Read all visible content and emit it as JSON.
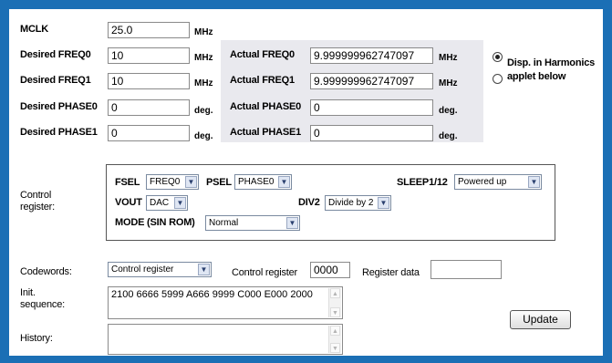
{
  "top": {
    "mclk": {
      "label": "MCLK",
      "value": "25.0",
      "unit": "MHz"
    },
    "freq0": {
      "label": "Desired FREQ0",
      "value": "10",
      "unit": "MHz"
    },
    "freq1": {
      "label": "Desired FREQ1",
      "value": "10",
      "unit": "MHz"
    },
    "phase0": {
      "label": "Desired PHASE0",
      "value": "0",
      "unit": "deg."
    },
    "phase1": {
      "label": "Desired PHASE1",
      "value": "0",
      "unit": "deg."
    },
    "actual_freq0": {
      "label": "Actual FREQ0",
      "value": "9.999999962747097",
      "unit": "MHz"
    },
    "actual_freq1": {
      "label": "Actual FREQ1",
      "value": "9.999999962747097",
      "unit": "MHz"
    },
    "actual_phase0": {
      "label": "Actual PHASE0",
      "value": "0",
      "unit": "deg."
    },
    "actual_phase1": {
      "label": "Actual PHASE1",
      "value": "0",
      "unit": "deg."
    },
    "radio_harmonics": "Disp. in Harmonics",
    "radio_applet": "applet below"
  },
  "control": {
    "label_line1": "Control",
    "label_line2": "register:",
    "fsel_label": "FSEL",
    "fsel_value": "FREQ0",
    "psel_label": "PSEL",
    "psel_value": "PHASE0",
    "sleep_label": "SLEEP1/12",
    "sleep_value": "Powered up",
    "vout_label": "VOUT",
    "vout_value": "DAC",
    "div2_label": "DIV2",
    "div2_value": "Divide by 2",
    "mode_label": "MODE (SIN ROM)",
    "mode_value": "Normal"
  },
  "bottom": {
    "codewords_label": "Codewords:",
    "codewords_value": "Control register",
    "control_register_label": "Control register",
    "control_register_value": "0000",
    "register_data_label": "Register data",
    "register_data_value": "",
    "init_label_line1": "Init.",
    "init_label_line2": "sequence:",
    "init_value": "2100 6666 5999 A666 9999 C000 E000 2000",
    "history_label": "History:",
    "history_value": "",
    "update_button": "Update"
  }
}
